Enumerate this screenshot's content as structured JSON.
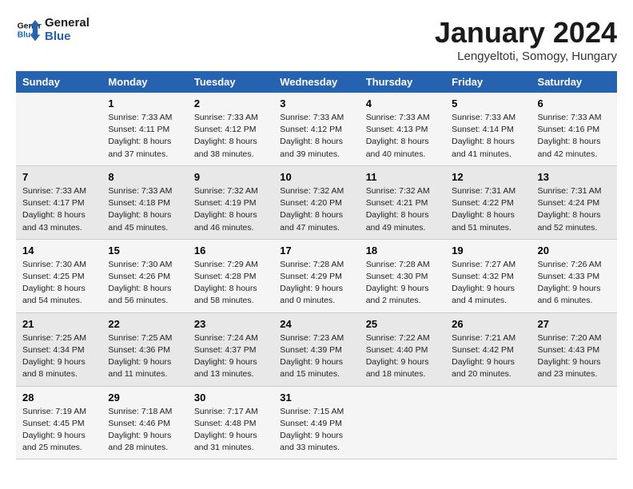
{
  "header": {
    "logo_line1": "General",
    "logo_line2": "Blue",
    "month_year": "January 2024",
    "location": "Lengyeltoti, Somogy, Hungary"
  },
  "weekdays": [
    "Sunday",
    "Monday",
    "Tuesday",
    "Wednesday",
    "Thursday",
    "Friday",
    "Saturday"
  ],
  "weeks": [
    [
      {
        "day": "",
        "sunrise": "",
        "sunset": "",
        "daylight": ""
      },
      {
        "day": "1",
        "sunrise": "Sunrise: 7:33 AM",
        "sunset": "Sunset: 4:11 PM",
        "daylight": "Daylight: 8 hours and 37 minutes."
      },
      {
        "day": "2",
        "sunrise": "Sunrise: 7:33 AM",
        "sunset": "Sunset: 4:12 PM",
        "daylight": "Daylight: 8 hours and 38 minutes."
      },
      {
        "day": "3",
        "sunrise": "Sunrise: 7:33 AM",
        "sunset": "Sunset: 4:12 PM",
        "daylight": "Daylight: 8 hours and 39 minutes."
      },
      {
        "day": "4",
        "sunrise": "Sunrise: 7:33 AM",
        "sunset": "Sunset: 4:13 PM",
        "daylight": "Daylight: 8 hours and 40 minutes."
      },
      {
        "day": "5",
        "sunrise": "Sunrise: 7:33 AM",
        "sunset": "Sunset: 4:14 PM",
        "daylight": "Daylight: 8 hours and 41 minutes."
      },
      {
        "day": "6",
        "sunrise": "Sunrise: 7:33 AM",
        "sunset": "Sunset: 4:16 PM",
        "daylight": "Daylight: 8 hours and 42 minutes."
      }
    ],
    [
      {
        "day": "7",
        "sunrise": "Sunrise: 7:33 AM",
        "sunset": "Sunset: 4:17 PM",
        "daylight": "Daylight: 8 hours and 43 minutes."
      },
      {
        "day": "8",
        "sunrise": "Sunrise: 7:33 AM",
        "sunset": "Sunset: 4:18 PM",
        "daylight": "Daylight: 8 hours and 45 minutes."
      },
      {
        "day": "9",
        "sunrise": "Sunrise: 7:32 AM",
        "sunset": "Sunset: 4:19 PM",
        "daylight": "Daylight: 8 hours and 46 minutes."
      },
      {
        "day": "10",
        "sunrise": "Sunrise: 7:32 AM",
        "sunset": "Sunset: 4:20 PM",
        "daylight": "Daylight: 8 hours and 47 minutes."
      },
      {
        "day": "11",
        "sunrise": "Sunrise: 7:32 AM",
        "sunset": "Sunset: 4:21 PM",
        "daylight": "Daylight: 8 hours and 49 minutes."
      },
      {
        "day": "12",
        "sunrise": "Sunrise: 7:31 AM",
        "sunset": "Sunset: 4:22 PM",
        "daylight": "Daylight: 8 hours and 51 minutes."
      },
      {
        "day": "13",
        "sunrise": "Sunrise: 7:31 AM",
        "sunset": "Sunset: 4:24 PM",
        "daylight": "Daylight: 8 hours and 52 minutes."
      }
    ],
    [
      {
        "day": "14",
        "sunrise": "Sunrise: 7:30 AM",
        "sunset": "Sunset: 4:25 PM",
        "daylight": "Daylight: 8 hours and 54 minutes."
      },
      {
        "day": "15",
        "sunrise": "Sunrise: 7:30 AM",
        "sunset": "Sunset: 4:26 PM",
        "daylight": "Daylight: 8 hours and 56 minutes."
      },
      {
        "day": "16",
        "sunrise": "Sunrise: 7:29 AM",
        "sunset": "Sunset: 4:28 PM",
        "daylight": "Daylight: 8 hours and 58 minutes."
      },
      {
        "day": "17",
        "sunrise": "Sunrise: 7:28 AM",
        "sunset": "Sunset: 4:29 PM",
        "daylight": "Daylight: 9 hours and 0 minutes."
      },
      {
        "day": "18",
        "sunrise": "Sunrise: 7:28 AM",
        "sunset": "Sunset: 4:30 PM",
        "daylight": "Daylight: 9 hours and 2 minutes."
      },
      {
        "day": "19",
        "sunrise": "Sunrise: 7:27 AM",
        "sunset": "Sunset: 4:32 PM",
        "daylight": "Daylight: 9 hours and 4 minutes."
      },
      {
        "day": "20",
        "sunrise": "Sunrise: 7:26 AM",
        "sunset": "Sunset: 4:33 PM",
        "daylight": "Daylight: 9 hours and 6 minutes."
      }
    ],
    [
      {
        "day": "21",
        "sunrise": "Sunrise: 7:25 AM",
        "sunset": "Sunset: 4:34 PM",
        "daylight": "Daylight: 9 hours and 8 minutes."
      },
      {
        "day": "22",
        "sunrise": "Sunrise: 7:25 AM",
        "sunset": "Sunset: 4:36 PM",
        "daylight": "Daylight: 9 hours and 11 minutes."
      },
      {
        "day": "23",
        "sunrise": "Sunrise: 7:24 AM",
        "sunset": "Sunset: 4:37 PM",
        "daylight": "Daylight: 9 hours and 13 minutes."
      },
      {
        "day": "24",
        "sunrise": "Sunrise: 7:23 AM",
        "sunset": "Sunset: 4:39 PM",
        "daylight": "Daylight: 9 hours and 15 minutes."
      },
      {
        "day": "25",
        "sunrise": "Sunrise: 7:22 AM",
        "sunset": "Sunset: 4:40 PM",
        "daylight": "Daylight: 9 hours and 18 minutes."
      },
      {
        "day": "26",
        "sunrise": "Sunrise: 7:21 AM",
        "sunset": "Sunset: 4:42 PM",
        "daylight": "Daylight: 9 hours and 20 minutes."
      },
      {
        "day": "27",
        "sunrise": "Sunrise: 7:20 AM",
        "sunset": "Sunset: 4:43 PM",
        "daylight": "Daylight: 9 hours and 23 minutes."
      }
    ],
    [
      {
        "day": "28",
        "sunrise": "Sunrise: 7:19 AM",
        "sunset": "Sunset: 4:45 PM",
        "daylight": "Daylight: 9 hours and 25 minutes."
      },
      {
        "day": "29",
        "sunrise": "Sunrise: 7:18 AM",
        "sunset": "Sunset: 4:46 PM",
        "daylight": "Daylight: 9 hours and 28 minutes."
      },
      {
        "day": "30",
        "sunrise": "Sunrise: 7:17 AM",
        "sunset": "Sunset: 4:48 PM",
        "daylight": "Daylight: 9 hours and 31 minutes."
      },
      {
        "day": "31",
        "sunrise": "Sunrise: 7:15 AM",
        "sunset": "Sunset: 4:49 PM",
        "daylight": "Daylight: 9 hours and 33 minutes."
      },
      {
        "day": "",
        "sunrise": "",
        "sunset": "",
        "daylight": ""
      },
      {
        "day": "",
        "sunrise": "",
        "sunset": "",
        "daylight": ""
      },
      {
        "day": "",
        "sunrise": "",
        "sunset": "",
        "daylight": ""
      }
    ]
  ]
}
